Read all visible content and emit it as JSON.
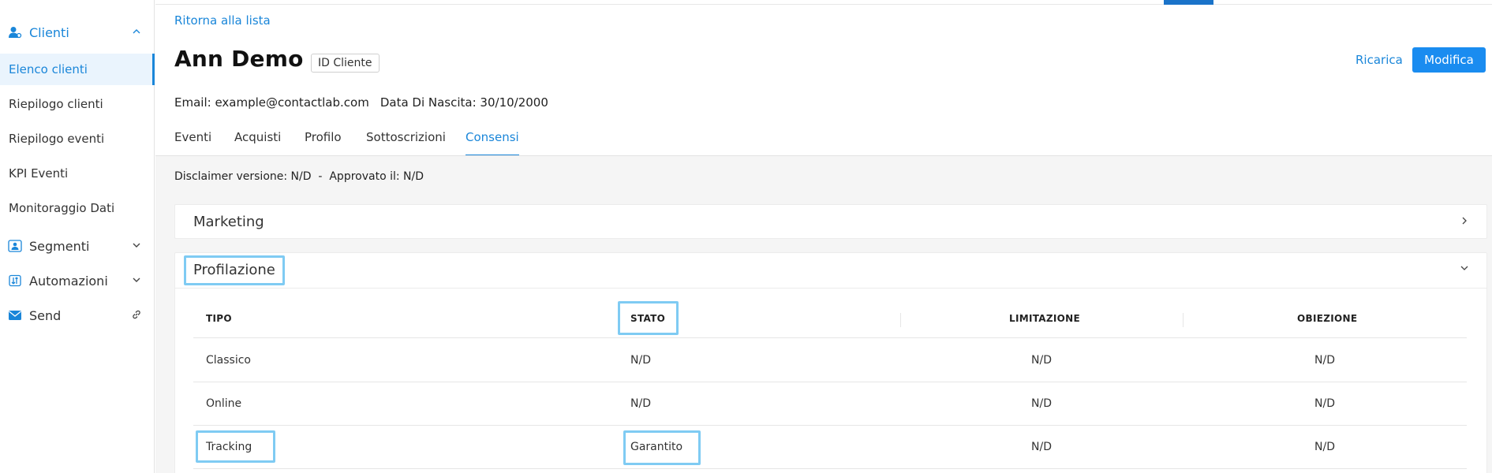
{
  "sidebar": {
    "groups": {
      "clienti": "Clienti",
      "segmenti": "Segmenti",
      "automazioni": "Automazioni",
      "send": "Send"
    },
    "items": [
      {
        "label": "Elenco clienti",
        "active": true
      },
      {
        "label": "Riepilogo clienti"
      },
      {
        "label": "Riepilogo eventi"
      },
      {
        "label": "KPI Eventi"
      },
      {
        "label": "Monitoraggio Dati"
      }
    ]
  },
  "header": {
    "back_link": "Ritorna alla lista",
    "customer_name": "Ann Demo",
    "id_badge": "ID Cliente",
    "reload": "Ricarica",
    "edit": "Modifica",
    "email": "Email: example@contactlab.com",
    "birth_date": "Data Di Nascita: 30/10/2000"
  },
  "tabs": [
    "Eventi",
    "Acquisti",
    "Profilo",
    "Sottoscrizioni",
    "Consensi"
  ],
  "active_tab": "Consensi",
  "disclaimer": "Disclaimer versione: N/D  -  Approvato il: N/D",
  "panels": {
    "marketing": "Marketing",
    "profilazione": "Profilazione"
  },
  "table": {
    "headers": [
      "TIPO",
      "STATO",
      "LIMITAZIONE",
      "OBIEZIONE"
    ],
    "rows": [
      [
        "Classico",
        "N/D",
        "N/D",
        "N/D"
      ],
      [
        "Online",
        "N/D",
        "N/D",
        "N/D"
      ],
      [
        "Tracking",
        "Garantito",
        "N/D",
        "N/D"
      ]
    ]
  },
  "colors": {
    "accent": "#1a86d9",
    "button": "#1a8cf0",
    "highlight": "#7fcbf3"
  },
  "icons": {
    "clienti": "person-icon",
    "segmenti": "segment-icon",
    "automazioni": "automation-icon",
    "send": "mail-icon",
    "send_link": "link-icon"
  }
}
